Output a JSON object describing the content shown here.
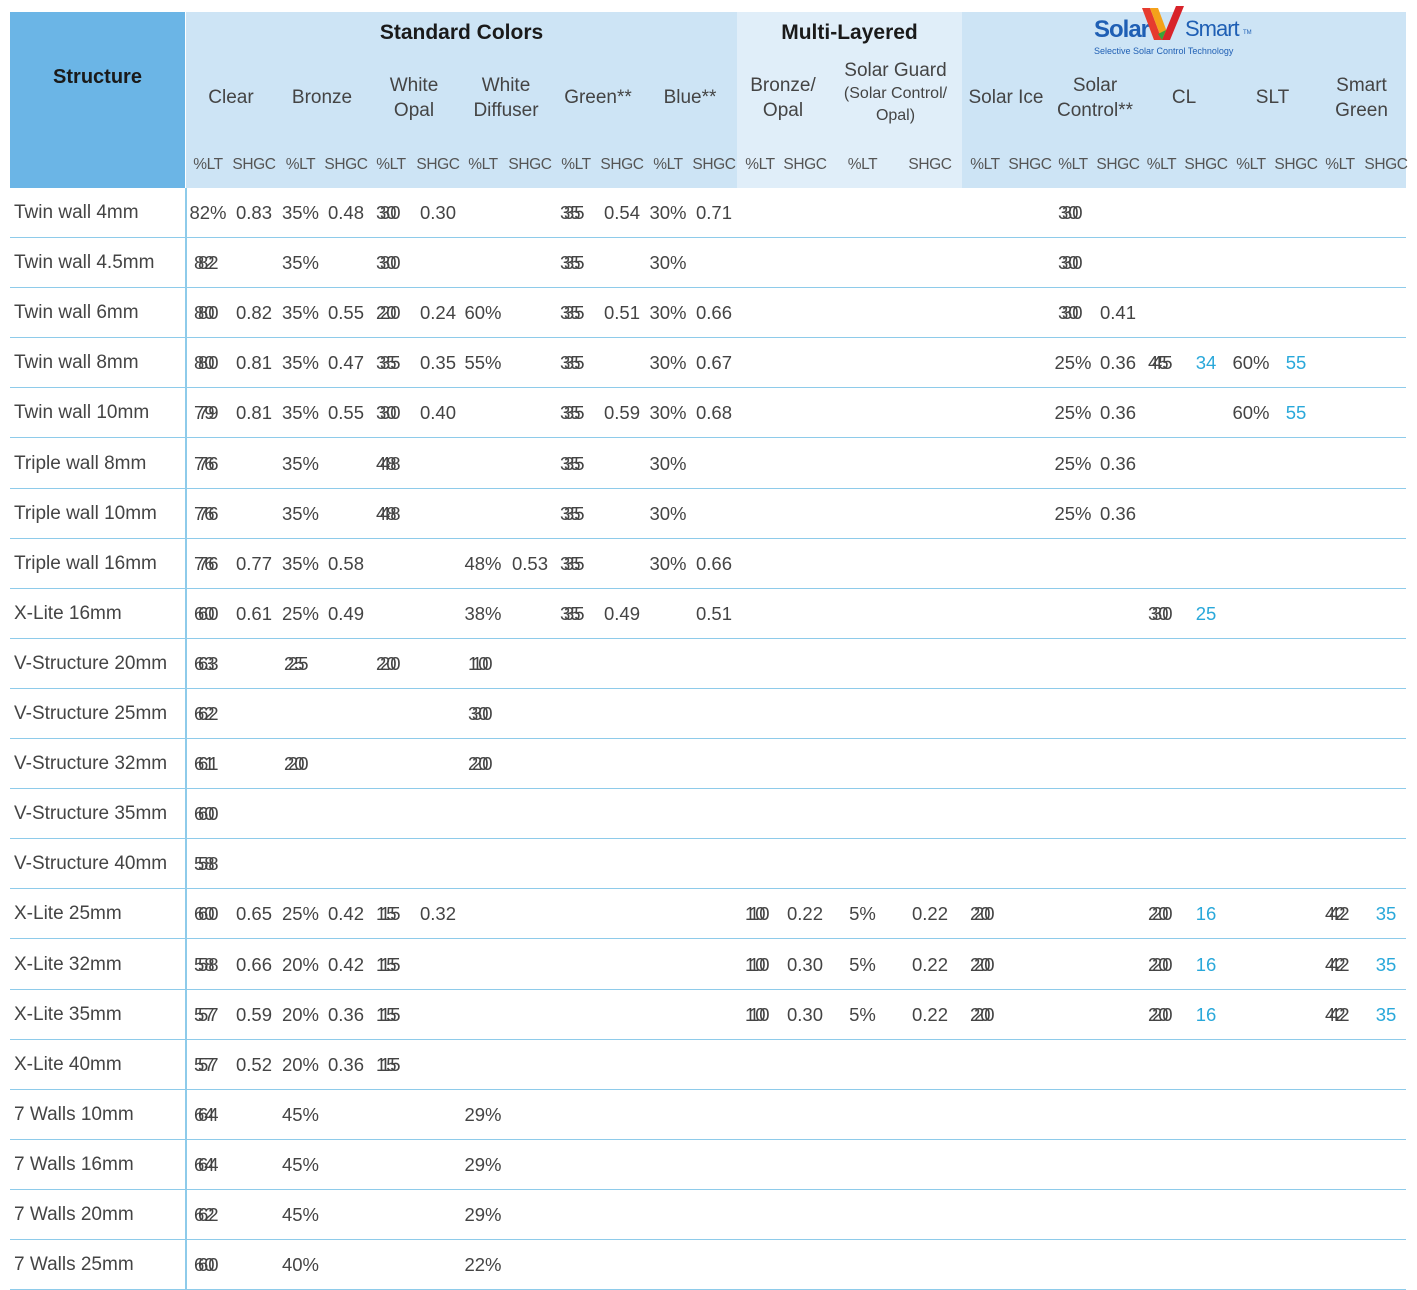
{
  "header": {
    "structure_label": "Structure",
    "groups": {
      "standard": "Standard Colors",
      "multi": "Multi-Layered",
      "solar_logo": {
        "word1": "Solar",
        "word2": "Smart",
        "tm": "TM",
        "tagline": "Selective Solar  Control Technology"
      }
    },
    "columns": [
      {
        "key": "clear",
        "lines": [
          "Clear"
        ]
      },
      {
        "key": "bronze",
        "lines": [
          "Bronze"
        ]
      },
      {
        "key": "white_opal",
        "lines": [
          "White",
          "Opal"
        ]
      },
      {
        "key": "white_diffuser",
        "lines": [
          "White",
          "Diffuser"
        ]
      },
      {
        "key": "green",
        "lines": [
          "Green**"
        ]
      },
      {
        "key": "blue",
        "lines": [
          "Blue**"
        ]
      },
      {
        "key": "bronze_opal",
        "lines": [
          "Bronze/",
          "Opal"
        ]
      },
      {
        "key": "solar_guard",
        "lines": [
          "Solar Guard"
        ],
        "sub_lines": [
          "(Solar Control/",
          "Opal)"
        ]
      },
      {
        "key": "solar_ice",
        "lines": [
          "Solar Ice"
        ]
      },
      {
        "key": "solar_control",
        "lines": [
          "Solar",
          "Control**"
        ]
      },
      {
        "key": "cl",
        "lines": [
          "CL"
        ]
      },
      {
        "key": "slt",
        "lines": [
          "SLT"
        ]
      },
      {
        "key": "smart_green",
        "lines": [
          "Smart",
          "Green"
        ]
      }
    ],
    "sub_labels": {
      "lt": "%LT",
      "shgc": "SHGC"
    }
  },
  "rows": [
    {
      "label": "Twin wall 4mm",
      "cells": {
        "clear_lt": "82%",
        "clear_shgc": "0.83",
        "bronze_lt": "35%",
        "bronze_shgc": "0.48",
        "white_opal_lt": "30/30",
        "white_opal_shgc": "0.30",
        "green_lt": "35/35",
        "green_shgc": "0.54",
        "blue_lt": "30%",
        "blue_shgc": "0.71",
        "solar_control_lt": "30/30"
      }
    },
    {
      "label": "Twin wall 4.5mm",
      "cells": {
        "clear_lt": "82/82",
        "bronze_lt": "35%",
        "white_opal_lt": "30/30",
        "green_lt": "35/35",
        "blue_lt": "30%",
        "solar_control_lt": "30/30"
      }
    },
    {
      "label": "Twin wall 6mm",
      "cells": {
        "clear_lt": "80/80",
        "clear_shgc": "0.82",
        "bronze_lt": "35%",
        "bronze_shgc": "0.55",
        "white_opal_lt": "20/20",
        "white_opal_shgc": "0.24",
        "white_diffuser_lt": "60%",
        "green_lt": "35/35",
        "green_shgc": "0.51",
        "blue_lt": "30%",
        "blue_shgc": "0.66",
        "solar_control_lt": "30/30",
        "solar_control_shgc": "0.41"
      }
    },
    {
      "label": "Twin wall 8mm",
      "cells": {
        "clear_lt": "80/80",
        "clear_shgc": "0.81",
        "bronze_lt": "35%",
        "bronze_shgc": "0.47",
        "white_opal_lt": "35/35",
        "white_opal_shgc": "0.35",
        "white_diffuser_lt": "55%",
        "green_lt": "35/35",
        "blue_lt": "30%",
        "blue_shgc": "0.67",
        "solar_control_lt": "25%",
        "solar_control_shgc": "0.36",
        "cl_lt": "45/45",
        "cl_shgc": "34",
        "slt_lt": "60%",
        "slt_shgc": "55"
      }
    },
    {
      "label": "Twin wall 10mm",
      "cells": {
        "clear_lt": "79/79",
        "clear_shgc": "0.81",
        "bronze_lt": "35%",
        "bronze_shgc": "0.55",
        "white_opal_lt": "30/30",
        "white_opal_shgc": "0.40",
        "green_lt": "35/35",
        "green_shgc": "0.59",
        "blue_lt": "30%",
        "blue_shgc": "0.68",
        "solar_control_lt": "25%",
        "solar_control_shgc": "0.36",
        "slt_lt": "60%",
        "slt_shgc": "55"
      }
    },
    {
      "label": "Triple wall 8mm",
      "cells": {
        "clear_lt": "76/76",
        "bronze_lt": "35%",
        "white_opal_lt": "48/48",
        "green_lt": "35/35",
        "blue_lt": "30%",
        "solar_control_lt": "25%",
        "solar_control_shgc": "0.36"
      }
    },
    {
      "label": "Triple wall 10mm",
      "cells": {
        "clear_lt": "76/76",
        "bronze_lt": "35%",
        "white_opal_lt": "48/48",
        "green_lt": "35/35",
        "blue_lt": "30%",
        "solar_control_lt": "25%",
        "solar_control_shgc": "0.36"
      }
    },
    {
      "label": "Triple wall 16mm",
      "cells": {
        "clear_lt": "76/76",
        "clear_shgc": "0.77",
        "bronze_lt": "35%",
        "bronze_shgc": "0.58",
        "white_diffuser_lt": "48%",
        "white_diffuser_shgc": "0.53",
        "green_lt": "35/35",
        "blue_lt": "30%",
        "blue_shgc": "0.66"
      }
    },
    {
      "label": "X-Lite 16mm",
      "cells": {
        "clear_lt": "60/60",
        "clear_shgc": "0.61",
        "bronze_lt": "25%",
        "bronze_shgc": "0.49",
        "white_diffuser_lt": "38%",
        "green_lt": "35/35",
        "green_shgc": "0.49",
        "blue_shgc": "0.51",
        "cl_lt": "30/30",
        "cl_shgc": "25"
      }
    },
    {
      "label": "V-Structure 20mm",
      "cells": {
        "clear_lt": "63/63",
        "bronze_lt": "25/25",
        "white_opal_lt": "20/20",
        "white_diffuser_lt": "10/10"
      }
    },
    {
      "label": "V-Structure 25mm",
      "cells": {
        "clear_lt": "62/62",
        "white_diffuser_lt": "30/30"
      }
    },
    {
      "label": "V-Structure 32mm",
      "cells": {
        "clear_lt": "61/61",
        "bronze_lt": "20/20",
        "white_diffuser_lt": "20/20"
      }
    },
    {
      "label": "V-Structure 35mm",
      "cells": {
        "clear_lt": "60/60"
      }
    },
    {
      "label": "V-Structure 40mm",
      "cells": {
        "clear_lt": "58/58"
      }
    },
    {
      "label": "X-Lite 25mm",
      "cells": {
        "clear_lt": "60/60",
        "clear_shgc": "0.65",
        "bronze_lt": "25%",
        "bronze_shgc": "0.42",
        "white_opal_lt": "15/15",
        "white_opal_shgc": "0.32",
        "bronze_opal_lt": "10/10",
        "bronze_opal_shgc": "0.22",
        "solar_guard_lt": "5%",
        "solar_guard_shgc": "0.22",
        "solar_ice_lt": "20/20",
        "cl_lt": "20/20",
        "cl_shgc": "16",
        "smart_green_lt": "42/42",
        "smart_green_shgc": "35"
      }
    },
    {
      "label": "X-Lite 32mm",
      "cells": {
        "clear_lt": "58/58",
        "clear_shgc": "0.66",
        "bronze_lt": "20%",
        "bronze_shgc": "0.42",
        "white_opal_lt": "15/15",
        "bronze_opal_lt": "10/10",
        "bronze_opal_shgc": "0.30",
        "solar_guard_lt": "5%",
        "solar_guard_shgc": "0.22",
        "solar_ice_lt": "20/20",
        "cl_lt": "20/20",
        "cl_shgc": "16",
        "smart_green_lt": "42/42",
        "smart_green_shgc": "35"
      }
    },
    {
      "label": "X-Lite 35mm",
      "cells": {
        "clear_lt": "57/57",
        "clear_shgc": "0.59",
        "bronze_lt": "20%",
        "bronze_shgc": "0.36",
        "white_opal_lt": "15/15",
        "bronze_opal_lt": "10/10",
        "bronze_opal_shgc": "0.30",
        "solar_guard_lt": "5%",
        "solar_guard_shgc": "0.22",
        "solar_ice_lt": "20/20",
        "cl_lt": "20/20",
        "cl_shgc": "16",
        "smart_green_lt": "42/42",
        "smart_green_shgc": "35"
      }
    },
    {
      "label": "X-Lite 40mm",
      "cells": {
        "clear_lt": "57/57",
        "clear_shgc": "0.52",
        "bronze_lt": "20%",
        "bronze_shgc": "0.36",
        "white_opal_lt": "15/15"
      }
    },
    {
      "label": "7 Walls 10mm",
      "cells": {
        "clear_lt": "64/64",
        "bronze_lt": "45%",
        "white_diffuser_lt": "29%"
      }
    },
    {
      "label": "7 Walls 16mm",
      "cells": {
        "clear_lt": "64/64",
        "bronze_lt": "45%",
        "white_diffuser_lt": "29%"
      }
    },
    {
      "label": "7 Walls 20mm",
      "cells": {
        "clear_lt": "62/62",
        "bronze_lt": "45%",
        "white_diffuser_lt": "29%"
      }
    },
    {
      "label": "7 Walls 25mm",
      "cells": {
        "clear_lt": "60/60",
        "bronze_lt": "40%",
        "white_diffuser_lt": "22%"
      }
    }
  ],
  "colors": {
    "structure_header": "#6bb5e6",
    "header_band": "#cde4f5",
    "multi_band": "#e0eef9",
    "row_line": "#8ecbea",
    "highlight_text": "#29a8da"
  },
  "blue_text_cols": [
    "cl_shgc",
    "slt_shgc",
    "smart_green_shgc"
  ]
}
